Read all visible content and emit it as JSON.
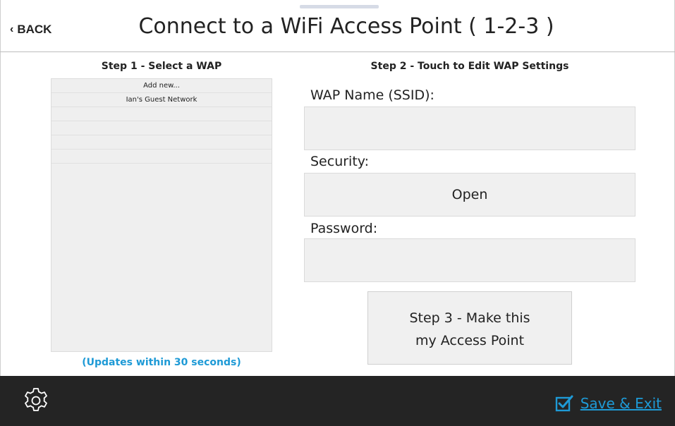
{
  "header": {
    "back_label": "BACK",
    "title": "Connect to a WiFi Access Point  ( 1-2-3 )"
  },
  "step1": {
    "heading": "Step 1 - Select a WAP",
    "items": [
      "Add new...",
      "Ian's Guest Network",
      "",
      "",
      "",
      "",
      ""
    ],
    "updates_note": "(Updates within 30 seconds)"
  },
  "step2": {
    "heading": "Step 2 - Touch to Edit WAP Settings",
    "ssid_label": "WAP Name (SSID):",
    "ssid_value": "",
    "security_label": "Security:",
    "security_value": "Open",
    "password_label": "Password:",
    "password_value": ""
  },
  "step3": {
    "line1": "Step 3 - Make this",
    "line2": "my Access Point"
  },
  "footer": {
    "settings_icon": "gear-icon",
    "save_exit_label": "Save & Exit",
    "save_icon": "checkbox-checked-icon"
  },
  "colors": {
    "accent": "#1e9ad6",
    "footer_bg": "#242424",
    "field_bg": "#f0f0f0"
  }
}
